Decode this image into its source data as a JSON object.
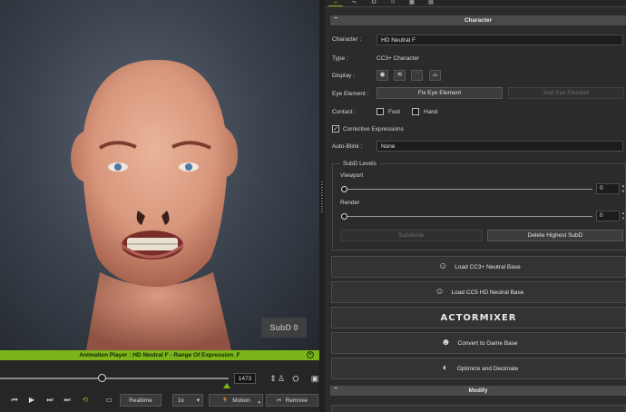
{
  "viewport": {
    "subd_badge": "SubD 0"
  },
  "animation_player": {
    "title": "Animation Player : HD Neutral F - Range Of Expression_F",
    "frame": "1473",
    "realtime_label": "Realtime",
    "speed_value": "1x",
    "motion_label": "Motion",
    "remove_label": "Remove"
  },
  "panel": {
    "section_title": "Character",
    "character_label": "Character :",
    "character_value": "HD Neutral F",
    "type_label": "Type :",
    "type_value": "CC3+ Character",
    "display_label": "Display :",
    "eye_element_label": "Eye Element :",
    "fix_eye_button": "Fix Eye Element",
    "add_eye_button": "Add Eye Element",
    "contact_label": "Contact :",
    "foot_label": "Foot",
    "hand_label": "Hand",
    "corrective_label": "Corrective Expressions",
    "auto_blink_label": "Auto-Blink :",
    "auto_blink_value": "None",
    "subd_group_title": "SubD Levels",
    "viewport_label": "Viewport",
    "viewport_value": "0",
    "render_label": "Render",
    "render_value": "0",
    "subdivide_button": "Subdivide",
    "delete_subd_button": "Delete Highest SubD",
    "load_cc3_button": "Load CC3+ Neutral Base",
    "load_cc5_button": "Load CC5 HD Neutral Base",
    "actormixer_logo": "ACTORMIXER",
    "convert_button": "Convert to Game Base",
    "optimize_button": "Optimize and Decimate",
    "modify_section": "Modify"
  },
  "colors": {
    "accent_green": "#7bb51a",
    "panel_bg": "#2b2b2b",
    "viewport_bg": "#3d4550"
  }
}
